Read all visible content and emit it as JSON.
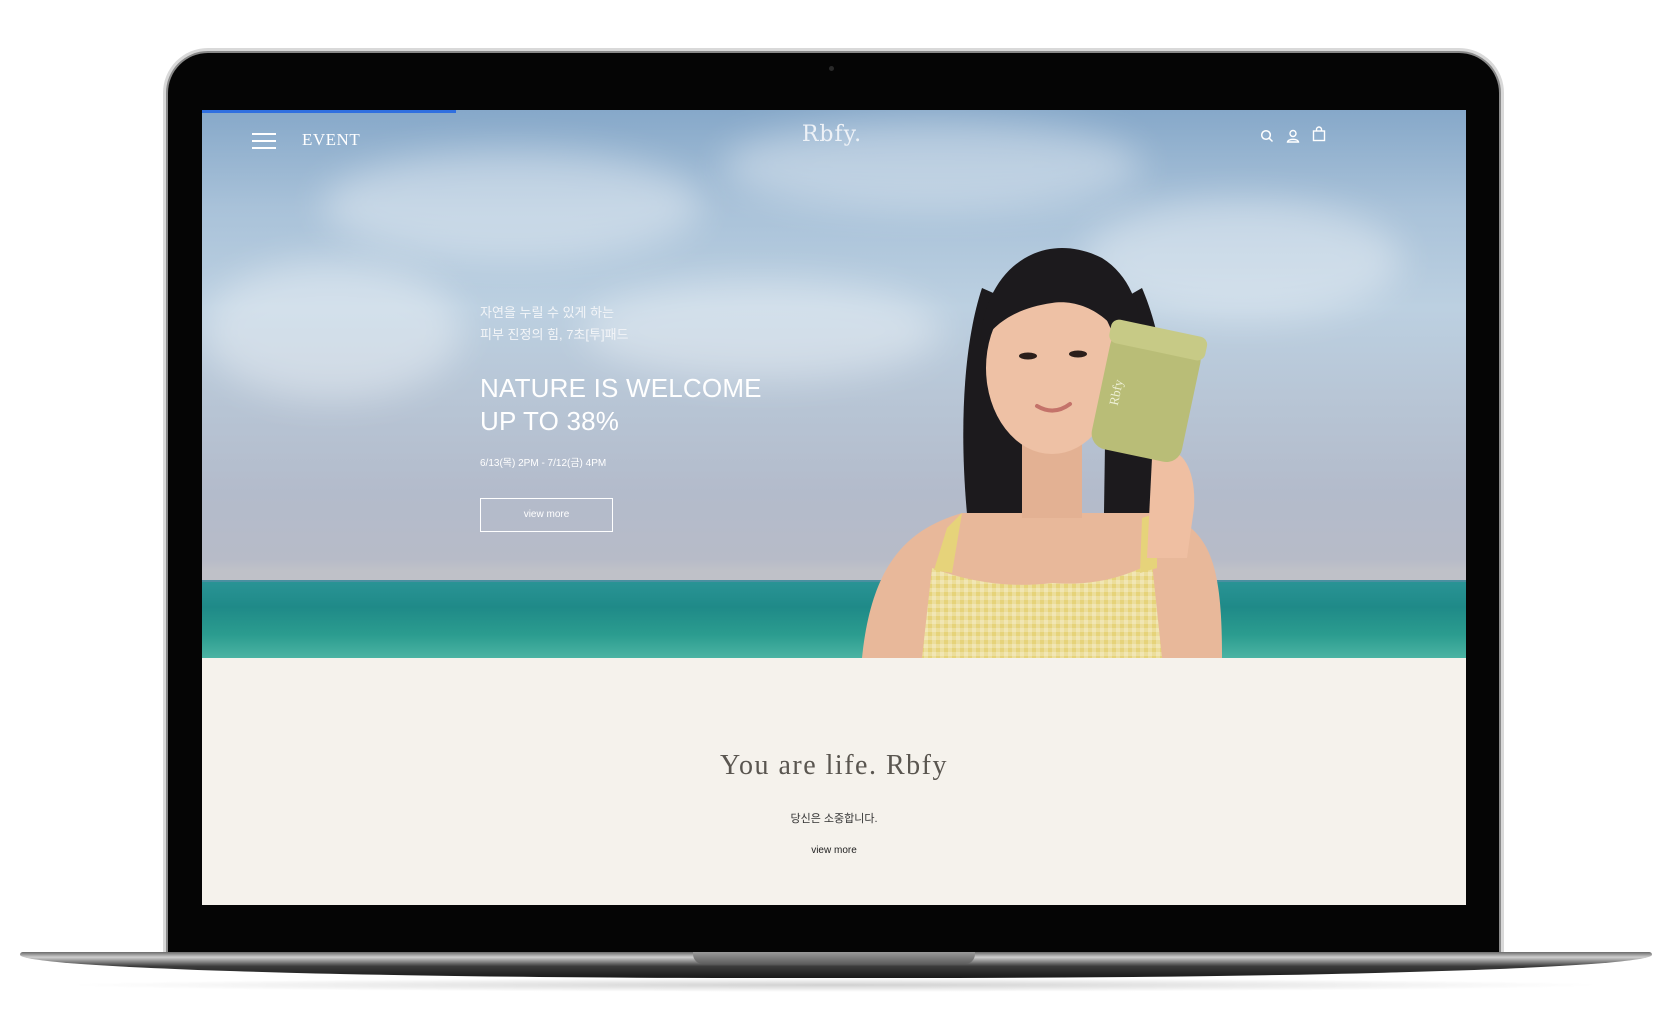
{
  "header": {
    "menu_icon": "hamburger-menu-icon",
    "event_label": "EVENT",
    "logo": "Rbfy.",
    "icons": [
      "search-icon",
      "user-icon",
      "shopping-bag-icon"
    ]
  },
  "hero": {
    "sub_line_1": "자연을 누릴 수 있게 하는",
    "sub_line_2": "피부 진정의 힘, 7초[투]패드",
    "headline_1": "NATURE IS WELCOME",
    "headline_2": "UP TO 38%",
    "date": "6/13(목) 2PM - 7/12(금) 4PM",
    "button_label": "view more",
    "product_label": "Rbfy"
  },
  "brand_section": {
    "tagline": "You are life. Rbfy",
    "subtitle": "당신은 소중합니다.",
    "link_label": "view more"
  },
  "colors": {
    "progress_accent": "#2f6fe0",
    "section_background": "#f5f2ec"
  }
}
